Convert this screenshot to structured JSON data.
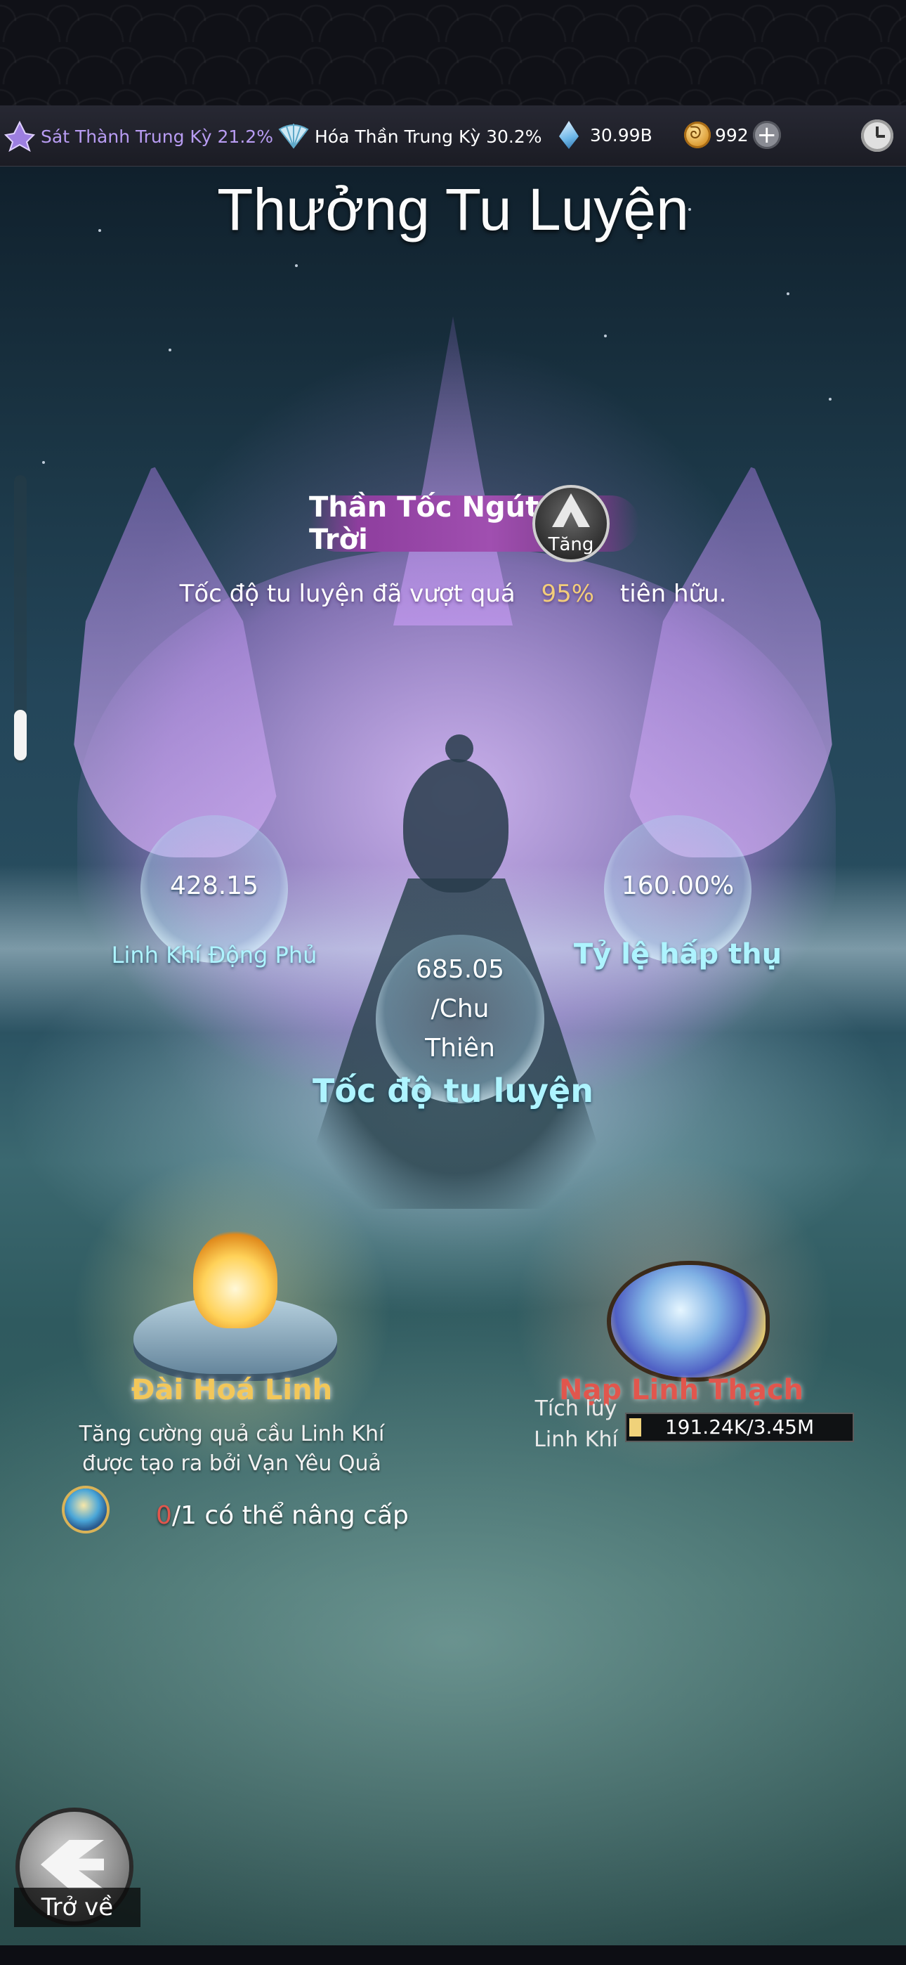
{
  "status_bar": {
    "realm1": "Sát Thành Trung Kỳ 21.2%",
    "realm2": "Hóa Thần Trung Kỳ 30.2%",
    "gems": "30.99B",
    "coins": "992",
    "plus": "+"
  },
  "title": "Thưởng Tu Luyện",
  "rank": {
    "name": "Thần Tốc Ngút Trời",
    "upgrade_label": "Tăng"
  },
  "percent_line": {
    "prefix": "Tốc độ tu luyện đã vượt quá",
    "value": "95%",
    "suffix": "tiên hữu."
  },
  "stats": {
    "left_value": "428.15",
    "left_label": "Linh Khí Động Phủ",
    "center_value_line1": "685.05",
    "center_value_line2": "/Chu",
    "center_value_line3": "Thiên",
    "center_label": "Tốc độ tu luyện",
    "right_value": "160.00%",
    "right_label": "Tỷ lệ hấp thụ"
  },
  "items": {
    "left_name": "Đài Hoá Linh",
    "left_desc_line1": "Tăng cường quả cầu Linh Khí",
    "left_desc_line2": "được tạo ra bởi Vạn Yêu Quả",
    "upgrade_current": "0",
    "upgrade_rest": "/1 có thể nâng cấp",
    "right_name": "Nạp Linh Thạch",
    "accum_line1": "Tích lũy",
    "accum_line2": "Linh Khí",
    "progress_text": "191.24K/3.45M",
    "progress_fraction": 0.055
  },
  "back_label": "Trở về",
  "colors": {
    "highlight": "#f3cd7a",
    "left_item": "#f2c75a",
    "right_item": "#e1564d",
    "stat_label": "#aef4ff",
    "realm1": "#b89cf2"
  }
}
